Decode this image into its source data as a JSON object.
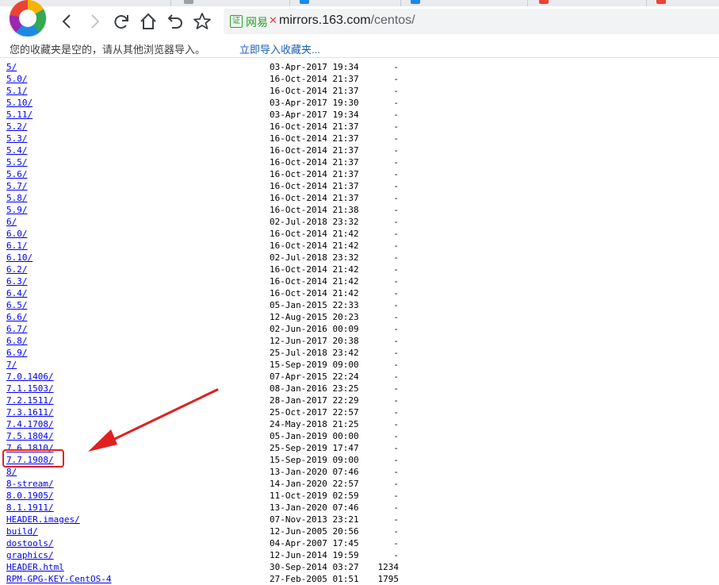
{
  "browser": {
    "address": {
      "secure_badge": "证",
      "site_name": "网易",
      "shield_glyph": "✕",
      "url_host": "mirrors.163.com",
      "url_path": "/centos/"
    },
    "bookmarks_bar": {
      "message": "您的收藏夹是空的，请从其他浏览器导入。",
      "import_link": "立即导入收藏夹..."
    },
    "icons": [
      "browser-logo",
      "back-icon",
      "forward-icon",
      "reload-icon",
      "home-icon",
      "undo-icon",
      "star-icon"
    ],
    "accent_colors": {
      "link": "#0000ee",
      "secure": "#2aa22a",
      "annotation": "#e02020"
    }
  },
  "listing": [
    {
      "name": "5/",
      "date": "03-Apr-2017 19:34",
      "size": "-"
    },
    {
      "name": "5.0/",
      "date": "16-Oct-2014 21:37",
      "size": "-"
    },
    {
      "name": "5.1/",
      "date": "16-Oct-2014 21:37",
      "size": "-"
    },
    {
      "name": "5.10/",
      "date": "03-Apr-2017 19:30",
      "size": "-"
    },
    {
      "name": "5.11/",
      "date": "03-Apr-2017 19:34",
      "size": "-"
    },
    {
      "name": "5.2/",
      "date": "16-Oct-2014 21:37",
      "size": "-"
    },
    {
      "name": "5.3/",
      "date": "16-Oct-2014 21:37",
      "size": "-"
    },
    {
      "name": "5.4/",
      "date": "16-Oct-2014 21:37",
      "size": "-"
    },
    {
      "name": "5.5/",
      "date": "16-Oct-2014 21:37",
      "size": "-"
    },
    {
      "name": "5.6/",
      "date": "16-Oct-2014 21:37",
      "size": "-"
    },
    {
      "name": "5.7/",
      "date": "16-Oct-2014 21:37",
      "size": "-"
    },
    {
      "name": "5.8/",
      "date": "16-Oct-2014 21:37",
      "size": "-"
    },
    {
      "name": "5.9/",
      "date": "16-Oct-2014 21:38",
      "size": "-"
    },
    {
      "name": "6/",
      "date": "02-Jul-2018 23:32",
      "size": "-"
    },
    {
      "name": "6.0/",
      "date": "16-Oct-2014 21:42",
      "size": "-"
    },
    {
      "name": "6.1/",
      "date": "16-Oct-2014 21:42",
      "size": "-"
    },
    {
      "name": "6.10/",
      "date": "02-Jul-2018 23:32",
      "size": "-"
    },
    {
      "name": "6.2/",
      "date": "16-Oct-2014 21:42",
      "size": "-"
    },
    {
      "name": "6.3/",
      "date": "16-Oct-2014 21:42",
      "size": "-"
    },
    {
      "name": "6.4/",
      "date": "16-Oct-2014 21:42",
      "size": "-"
    },
    {
      "name": "6.5/",
      "date": "05-Jan-2015 22:33",
      "size": "-"
    },
    {
      "name": "6.6/",
      "date": "12-Aug-2015 20:23",
      "size": "-"
    },
    {
      "name": "6.7/",
      "date": "02-Jun-2016 00:09",
      "size": "-"
    },
    {
      "name": "6.8/",
      "date": "12-Jun-2017 20:38",
      "size": "-"
    },
    {
      "name": "6.9/",
      "date": "25-Jul-2018 23:42",
      "size": "-"
    },
    {
      "name": "7/",
      "date": "15-Sep-2019 09:00",
      "size": "-"
    },
    {
      "name": "7.0.1406/",
      "date": "07-Apr-2015 22:24",
      "size": "-"
    },
    {
      "name": "7.1.1503/",
      "date": "08-Jan-2016 23:25",
      "size": "-"
    },
    {
      "name": "7.2.1511/",
      "date": "28-Jan-2017 22:29",
      "size": "-"
    },
    {
      "name": "7.3.1611/",
      "date": "25-Oct-2017 22:57",
      "size": "-"
    },
    {
      "name": "7.4.1708/",
      "date": "24-May-2018 21:25",
      "size": "-"
    },
    {
      "name": "7.5.1804/",
      "date": "05-Jan-2019 00:00",
      "size": "-"
    },
    {
      "name": "7.6.1810/",
      "date": "25-Sep-2019 17:47",
      "size": "-"
    },
    {
      "name": "7.7.1908/",
      "date": "15-Sep-2019 09:00",
      "size": "-",
      "highlighted": true
    },
    {
      "name": "8/",
      "date": "13-Jan-2020 07:46",
      "size": "-"
    },
    {
      "name": "8-stream/",
      "date": "14-Jan-2020 22:57",
      "size": "-"
    },
    {
      "name": "8.0.1905/",
      "date": "11-Oct-2019 02:59",
      "size": "-"
    },
    {
      "name": "8.1.1911/",
      "date": "13-Jan-2020 07:46",
      "size": "-"
    },
    {
      "name": "HEADER.images/",
      "date": "07-Nov-2013 23:21",
      "size": "-"
    },
    {
      "name": "build/",
      "date": "12-Jun-2005 20:56",
      "size": "-"
    },
    {
      "name": "dostools/",
      "date": "04-Apr-2007 17:45",
      "size": "-"
    },
    {
      "name": "graphics/",
      "date": "12-Jun-2014 19:59",
      "size": "-"
    },
    {
      "name": "HEADER.html",
      "date": "30-Sep-2014 03:27",
      "size": "1234"
    },
    {
      "name": "RPM-GPG-KEY-CentOS-4",
      "date": "27-Feb-2005 01:51",
      "size": "1795"
    }
  ]
}
